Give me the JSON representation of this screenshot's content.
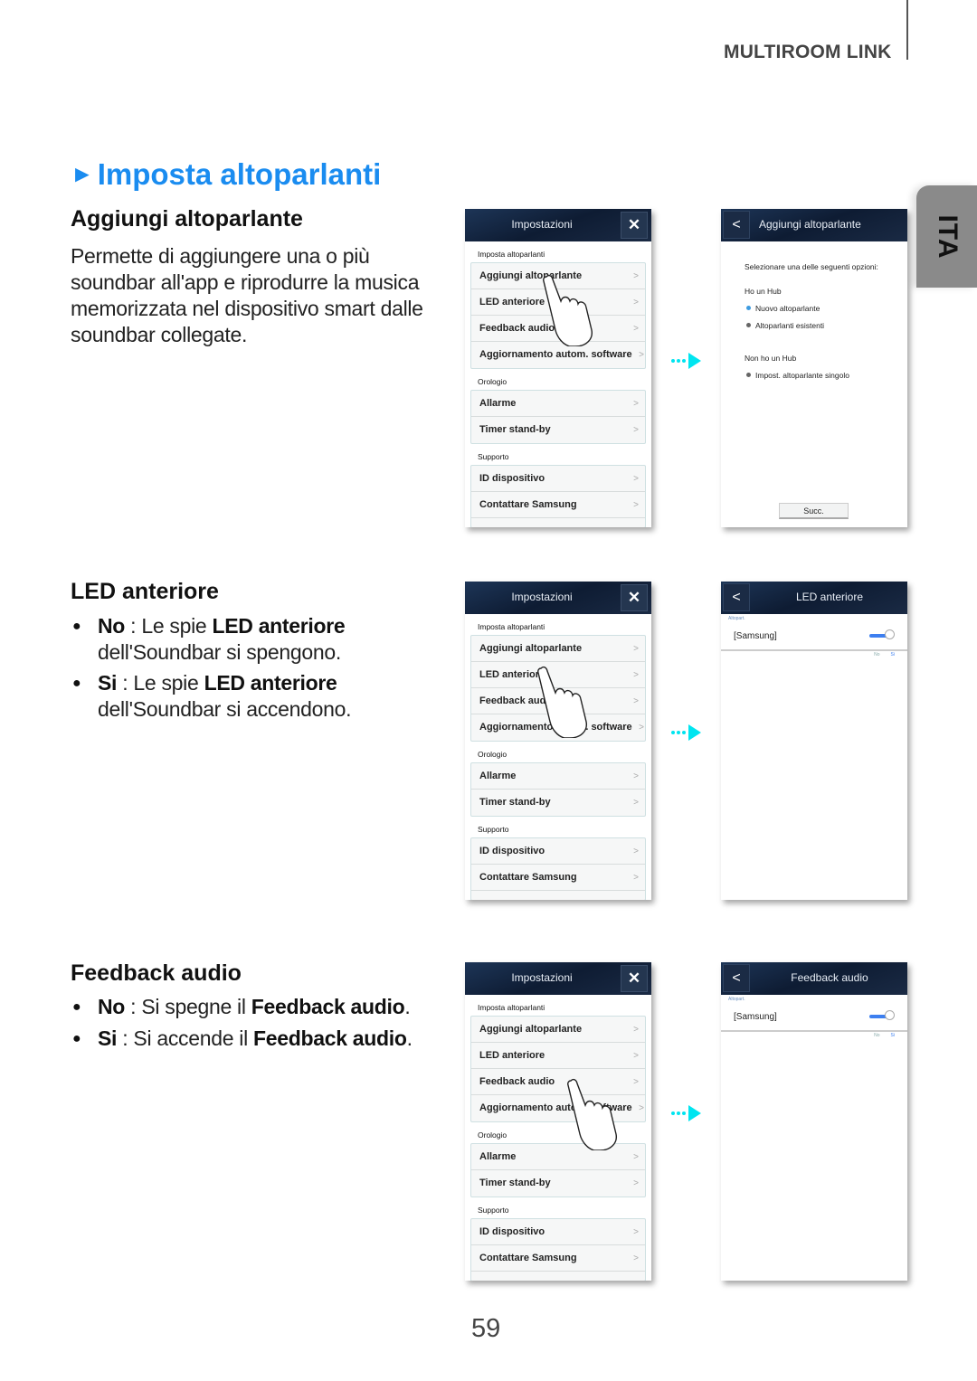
{
  "header": {
    "section_label": "MULTIROOM LINK"
  },
  "language_tab": {
    "label": "ITA"
  },
  "page_title": {
    "marker": "►",
    "text": "Imposta altoparlanti"
  },
  "sections": [
    {
      "heading": "Aggiungi altoparlante",
      "body": "Permette di aggiungere una o più soundbar all'app e riprodurre la musica memorizzata nel dispositivo smart dalle soundbar collegate."
    },
    {
      "heading": "LED anteriore",
      "bullets": [
        {
          "key": "No",
          "sep": " : Le spie ",
          "em": "LED anteriore",
          "tail": " dell'Soundbar si spengono."
        },
        {
          "key": "Si",
          "sep": " : Le spie ",
          "em": "LED anteriore",
          "tail": " dell'Soundbar si accendono."
        }
      ]
    },
    {
      "heading": "Feedback audio",
      "bullets": [
        {
          "key": "No",
          "sep": " : Si spegne il ",
          "em": "Feedback audio",
          "tail": "."
        },
        {
          "key": "Si",
          "sep": " : Si accende il ",
          "em": "Feedback audio",
          "tail": "."
        }
      ]
    }
  ],
  "settings_screen": {
    "title": "Impostazioni",
    "close_icon": "close-icon",
    "groups": [
      {
        "label": "Imposta altoparlanti",
        "items": [
          "Aggiungi altoparlante",
          "LED anteriore",
          "Feedback audio",
          "Aggiornamento autom. software"
        ]
      },
      {
        "label": "Orologio",
        "items": [
          "Allarme",
          "Timer stand-by"
        ]
      },
      {
        "label": "Supporto",
        "items": [
          "ID dispositivo",
          "Contattare Samsung"
        ]
      }
    ],
    "chevron": ">"
  },
  "add_speaker_screen": {
    "title": "Aggiungi altoparlante",
    "back_icon": "<",
    "prompt": "Selezionare una delle seguenti opzioni:",
    "hub_heading": "Ho un Hub",
    "hub_options": [
      "Nuovo altoparlante",
      "Altoparlanti esistenti"
    ],
    "no_hub_heading": "Non ho un Hub",
    "no_hub_options": [
      "Impost. altoparlante singolo"
    ],
    "next_button": "Succ."
  },
  "led_screen": {
    "title": "LED anteriore",
    "back_icon": "<",
    "breadcrumb": "Altopart.",
    "device": "[Samsung]",
    "switch_labels": [
      "No",
      "Si"
    ],
    "switch_state": "Si"
  },
  "feedback_screen": {
    "title": "Feedback audio",
    "back_icon": "<",
    "breadcrumb": "Altopart.",
    "device": "[Samsung]",
    "switch_labels": [
      "No",
      "Si"
    ],
    "switch_state": "Si"
  },
  "colors": {
    "accent": "#1a8cf0",
    "arrow": "#00e5f0",
    "tab": "#8a8a8a",
    "toggle": "#3d7ff0"
  },
  "page_number": "59"
}
